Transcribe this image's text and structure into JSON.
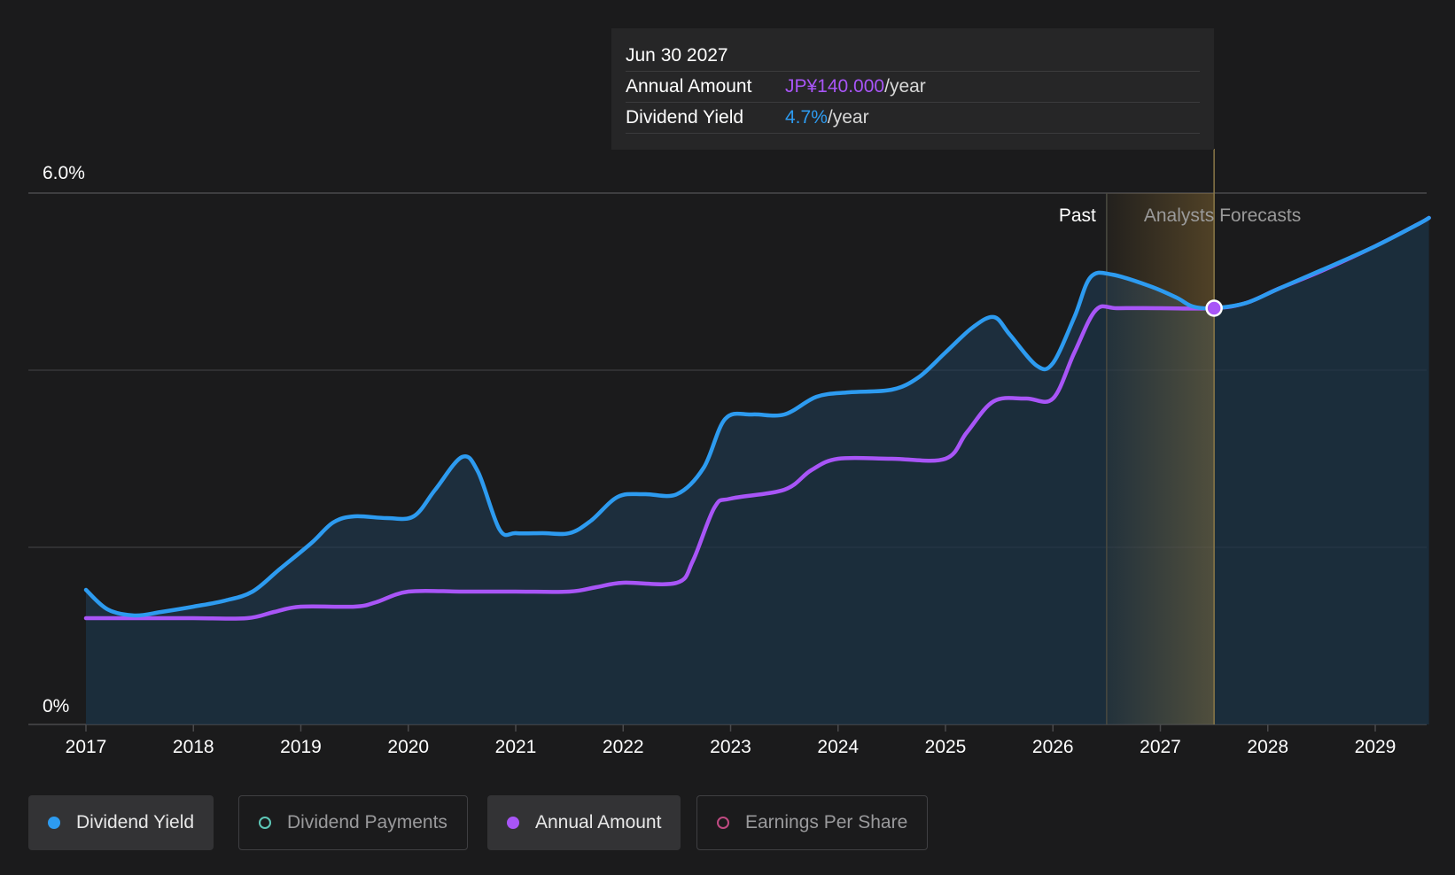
{
  "chart_data": {
    "type": "area",
    "ylim": [
      0,
      6.0
    ],
    "y_tick_labels": [
      "0%",
      "6.0%"
    ],
    "x_tick_labels": [
      "2017",
      "2018",
      "2019",
      "2020",
      "2021",
      "2022",
      "2023",
      "2024",
      "2025",
      "2026",
      "2027",
      "2028",
      "2029"
    ],
    "grid": true,
    "past_label": "Past",
    "forecast_label": "Analysts Forecasts",
    "series": [
      {
        "name": "Dividend Yield",
        "color": "#2d9bf0",
        "points": [
          [
            2017.0,
            1.52
          ],
          [
            2017.2,
            1.3
          ],
          [
            2017.45,
            1.23
          ],
          [
            2017.7,
            1.27
          ],
          [
            2018.0,
            1.33
          ],
          [
            2018.3,
            1.4
          ],
          [
            2018.55,
            1.5
          ],
          [
            2018.8,
            1.75
          ],
          [
            2019.1,
            2.05
          ],
          [
            2019.3,
            2.28
          ],
          [
            2019.5,
            2.35
          ],
          [
            2019.8,
            2.33
          ],
          [
            2020.05,
            2.35
          ],
          [
            2020.25,
            2.65
          ],
          [
            2020.5,
            3.02
          ],
          [
            2020.65,
            2.85
          ],
          [
            2020.85,
            2.2
          ],
          [
            2021.0,
            2.16
          ],
          [
            2021.25,
            2.16
          ],
          [
            2021.5,
            2.16
          ],
          [
            2021.7,
            2.3
          ],
          [
            2021.95,
            2.57
          ],
          [
            2022.2,
            2.6
          ],
          [
            2022.5,
            2.6
          ],
          [
            2022.75,
            2.9
          ],
          [
            2022.95,
            3.45
          ],
          [
            2023.2,
            3.5
          ],
          [
            2023.5,
            3.5
          ],
          [
            2023.8,
            3.7
          ],
          [
            2024.1,
            3.75
          ],
          [
            2024.5,
            3.78
          ],
          [
            2024.75,
            3.92
          ],
          [
            2025.0,
            4.2
          ],
          [
            2025.25,
            4.48
          ],
          [
            2025.45,
            4.6
          ],
          [
            2025.6,
            4.4
          ],
          [
            2025.85,
            4.05
          ],
          [
            2026.0,
            4.08
          ],
          [
            2026.2,
            4.6
          ],
          [
            2026.35,
            5.05
          ],
          [
            2026.55,
            5.08
          ],
          [
            2026.9,
            4.95
          ],
          [
            2027.15,
            4.82
          ],
          [
            2027.3,
            4.72
          ],
          [
            2027.5,
            4.7
          ],
          [
            2027.8,
            4.76
          ],
          [
            2028.1,
            4.92
          ],
          [
            2028.5,
            5.13
          ],
          [
            2029.0,
            5.4
          ],
          [
            2029.4,
            5.65
          ],
          [
            2029.5,
            5.72
          ]
        ]
      },
      {
        "name": "Annual Amount",
        "color": "#a855f7",
        "points": [
          [
            2017.0,
            1.2
          ],
          [
            2017.5,
            1.2
          ],
          [
            2018.0,
            1.2
          ],
          [
            2018.5,
            1.2
          ],
          [
            2018.75,
            1.27
          ],
          [
            2019.0,
            1.33
          ],
          [
            2019.5,
            1.33
          ],
          [
            2019.7,
            1.38
          ],
          [
            2020.0,
            1.5
          ],
          [
            2020.5,
            1.5
          ],
          [
            2021.0,
            1.5
          ],
          [
            2021.5,
            1.5
          ],
          [
            2021.75,
            1.55
          ],
          [
            2022.0,
            1.6
          ],
          [
            2022.5,
            1.6
          ],
          [
            2022.65,
            1.85
          ],
          [
            2022.85,
            2.45
          ],
          [
            2023.0,
            2.55
          ],
          [
            2023.5,
            2.65
          ],
          [
            2023.75,
            2.87
          ],
          [
            2024.0,
            3.0
          ],
          [
            2024.5,
            3.0
          ],
          [
            2025.0,
            3.0
          ],
          [
            2025.2,
            3.3
          ],
          [
            2025.45,
            3.65
          ],
          [
            2025.75,
            3.68
          ],
          [
            2026.0,
            3.68
          ],
          [
            2026.2,
            4.2
          ],
          [
            2026.4,
            4.68
          ],
          [
            2026.6,
            4.7
          ],
          [
            2027.0,
            4.7
          ],
          [
            2027.5,
            4.7
          ],
          [
            2027.8,
            4.76
          ],
          [
            2028.1,
            4.92
          ],
          [
            2028.5,
            5.12
          ],
          [
            2029.0,
            5.4
          ],
          [
            2029.4,
            5.65
          ],
          [
            2029.5,
            5.72
          ]
        ]
      }
    ],
    "marker": {
      "x": 2027.5,
      "y": 4.7
    },
    "forecast_start": 2026.5,
    "highlight_end": 2027.5
  },
  "tooltip": {
    "date": "Jun 30 2027",
    "rows": [
      {
        "label": "Annual Amount",
        "value": "JP¥140.000",
        "unit": "/year",
        "color": "#a855f7"
      },
      {
        "label": "Dividend Yield",
        "value": "4.7%",
        "unit": "/year",
        "color": "#2d9bf0"
      }
    ]
  },
  "legend": [
    {
      "label": "Dividend Yield",
      "color": "#2d9bf0",
      "active": true
    },
    {
      "label": "Dividend Payments",
      "color": "#5ec8b8",
      "active": false
    },
    {
      "label": "Annual Amount",
      "color": "#a855f7",
      "active": true
    },
    {
      "label": "Earnings Per Share",
      "color": "#c04a82",
      "active": false
    }
  ]
}
